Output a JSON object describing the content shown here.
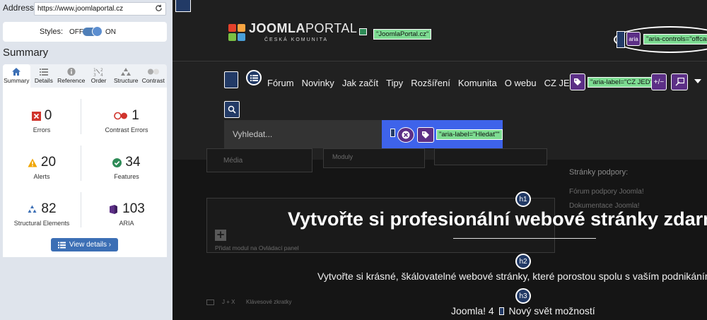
{
  "address": {
    "label": "Address:",
    "url": "https://www.joomlaportal.cz"
  },
  "styles": {
    "label": "Styles:",
    "off": "OFF",
    "on": "ON"
  },
  "summary": {
    "heading": "Summary"
  },
  "tabs": [
    {
      "label": "Summary",
      "icon": "home-icon"
    },
    {
      "label": "Details",
      "icon": "list-icon"
    },
    {
      "label": "Reference",
      "icon": "info-icon"
    },
    {
      "label": "Order",
      "icon": "order-icon"
    },
    {
      "label": "Structure",
      "icon": "structure-icon"
    },
    {
      "label": "Contrast",
      "icon": "contrast-icon"
    }
  ],
  "stats": {
    "errors": {
      "value": "0",
      "caption": "Errors",
      "color": "#d0342c"
    },
    "contrast": {
      "value": "1",
      "caption": "Contrast Errors",
      "color": "#d0342c"
    },
    "alerts": {
      "value": "20",
      "caption": "Alerts",
      "color": "#f0a500"
    },
    "features": {
      "value": "34",
      "caption": "Features",
      "color": "#2e8b57"
    },
    "structural": {
      "value": "82",
      "caption": "Structural Elements",
      "color": "#3c6fb5"
    },
    "aria": {
      "value": "103",
      "caption": "ARIA",
      "color": "#5c2f86"
    }
  },
  "view_details": "View details ›",
  "site": {
    "logo_a": "JOOMLA",
    "logo_b": "PORTAL",
    "logo_sub": "ČESKÁ KOMUNITA",
    "title_label": "\"JoomlaPortal.cz\"",
    "aria_controls": "\"aria-controls=\"offcanvas",
    "aria_badge": "aria",
    "nav": [
      "Fórum",
      "Novinky",
      "Jak začít",
      "Tipy",
      "Rozšíření",
      "Komunita",
      "O webu",
      "CZ JED"
    ],
    "cz_label": "\"aria-label=\"CZ JED\"\"",
    "search_placeholder": "Vyhledat...",
    "search_label": "\"aria-label=\"Hledat\"\"",
    "faded": {
      "media": "Média",
      "modules": "Moduly",
      "support": "Stránky podpory:",
      "forum_link": "Fórum podpory Joomla!",
      "docs_link": "Dokumentace Joomla!",
      "add_module": "Přidat modul na Ovládací panel",
      "shortcuts": "Klávesové zkratky",
      "shortcut_keys": "J + X"
    },
    "h1_badge": "h1",
    "h1": "Vytvořte si profesionální webové stránky zdarma",
    "h2_badge": "h2",
    "h2": "Vytvořte si krásné, škálovatelné webové stránky, které porostou spolu s vaším podnikáním",
    "h3_badge": "h3",
    "h3_a": "Joomla! 4",
    "h3_b": "Nový svět možností"
  }
}
